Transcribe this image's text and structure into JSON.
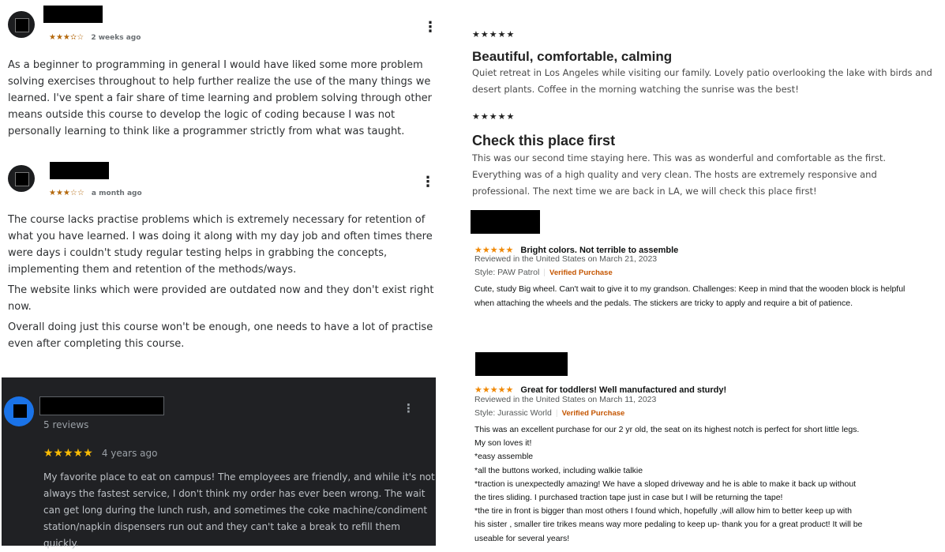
{
  "udemy": {
    "review1": {
      "stars": "★★★✫☆",
      "time": "2 weeks ago",
      "text": "As a beginner to programming in general I would have liked some more problem solving exercises throughout to help further realize the use of the many things we learned. I've spent a fair share of time learning and problem solving through other means outside this course to develop the logic of coding because I was not personally learning to think like a programmer strictly from what was taught."
    },
    "review2": {
      "stars": "★★★☆☆",
      "time": "a month ago",
      "paragraphs": [
        "The course lacks practise problems which is extremely necessary for retention of what you have learned. I was doing it along with my day job and often times there were days i couldn't study regular testing helps in grabbing the concepts, implementing them and retention of the methods/ways.",
        "The website links which were provided are outdated now and they don't exist right now.",
        "Overall doing just this course won't be enough, one needs to have a lot of practise even after completing this course."
      ]
    }
  },
  "google": {
    "reviews_count": "5 reviews",
    "stars": "★★★★★",
    "time": "4 years ago",
    "text": "My favorite place to eat on campus!  The employees are friendly, and while it's not always the fastest service, I don't think my order has ever been wrong. The wait can get long during the lunch rush, and sometimes the coke machine/condiment station/napkin dispensers run out  and they can't take a break to refill them quickly."
  },
  "airbnb": {
    "review1": {
      "stars": "★★★★★",
      "title": "Beautiful, comfortable, calming",
      "text": "Quiet retreat in Los Angeles while visiting our family. Lovely patio overlooking the lake with birds and desert plants. Coffee in the morning watching the sunrise was the best!"
    },
    "review2": {
      "stars": "★★★★★",
      "title": "Check this place first",
      "text": "This was our second time staying here. This was as wonderful and comfortable as the first. Everything was of a high quality and very clean. The hosts are extremely responsive and professional. The next time we are back in LA, we will check this place first!"
    }
  },
  "amazon": {
    "review1": {
      "stars": "★★★★★",
      "title": "Bright colors. Not terrible to assemble",
      "reviewed": "Reviewed in the United States on March 21, 2023",
      "style": "Style: PAW Patrol",
      "verified": "Verified Purchase",
      "text": "Cute, study Big wheel. Can't wait to give it to my grandson. Challenges: Keep in mind that the wooden block is helpful when attaching the wheels and the pedals. The stickers are tricky to apply and require a bit of patience."
    },
    "review2": {
      "stars": "★★★★★",
      "title": "Great for toddlers! Well manufactured and sturdy!",
      "reviewed": "Reviewed in the United States on March 11, 2023",
      "style": "Style: Jurassic World",
      "verified": "Verified Purchase",
      "lines": [
        "This was an excellent purchase for our 2 yr old, the seat on its highest notch is perfect for short little legs.",
        "My son loves it!",
        "*easy assemble",
        "*all the buttons worked, including walkie talkie",
        "*traction is unexpectedly amazing! We have a sloped driveway and he is able to make it back up without",
        "the tires sliding. I purchased traction tape just in case but I will be returning the tape!",
        "*the tire in front is bigger than most others I found which, hopefully ,will allow him to better keep up with",
        "his sister , smaller tire trikes means way more pedaling to keep up- thank you for a great product! It will be",
        "useable for several years!"
      ]
    }
  },
  "icons": {
    "more": "⋮"
  }
}
